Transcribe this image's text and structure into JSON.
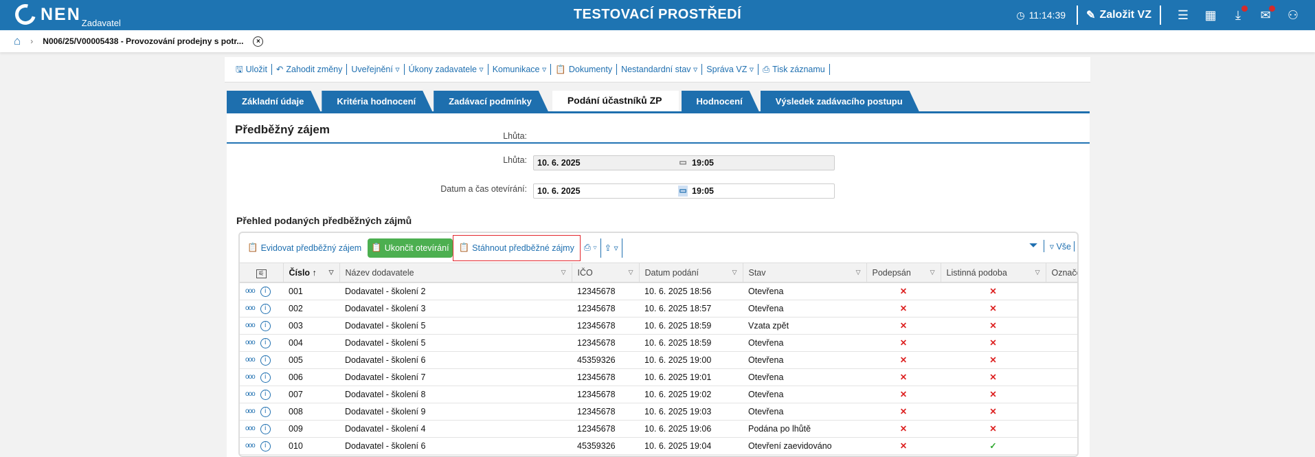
{
  "header": {
    "logo_text": "NEN",
    "logo_sub": "Zadavatel",
    "env_title": "TESTOVACÍ PROSTŘEDÍ",
    "time": "11:14:39",
    "create_label": "Založit VZ"
  },
  "breadcrumb": {
    "title": "N006/25/V00005438 - Provozování prodejny s potr..."
  },
  "toolbar": [
    "Uložit",
    "Zahodit změny",
    "Uveřejnění ▿",
    "Úkony zadavatele ▿",
    "Komunikace ▿",
    "Dokumenty",
    "Nestandardní stav ▿",
    "Správa VZ ▿",
    "Tisk záznamu"
  ],
  "tabs": [
    "Základní údaje",
    "Kritéria hodnocení",
    "Zadávací podmínky",
    "Podání účastníků ZP",
    "Hodnocení",
    "Výsledek zadávacího postupu"
  ],
  "section": {
    "title": "Předběžný zájem",
    "lhuta": {
      "label": "Lhůta:",
      "date": "10. 6. 2025",
      "time": "19:05"
    },
    "otevirani": {
      "label": "Datum a čas otevírání:",
      "date": "10. 6. 2025",
      "time": "19:05"
    }
  },
  "grid": {
    "title": "Přehled podaných předběžných zájmů",
    "buttons": {
      "evidovat": "Evidovat předběžný zájem",
      "ukoncit": "Ukončit otevírání",
      "stahnout": "Stáhnout předběžné zájmy",
      "all": "Vše"
    },
    "columns": [
      "Číslo",
      "Název dodavatele",
      "IČO",
      "Datum podání",
      "Stav",
      "Podepsán",
      "Listinná podoba",
      "Označe"
    ],
    "rows": [
      {
        "cislo": "001",
        "nazev": "Dodavatel - školení 2",
        "ico": "12345678",
        "datum": "10. 6. 2025 18:56",
        "stav": "Otevřena",
        "podepsan": "✕",
        "listinna": "✕"
      },
      {
        "cislo": "002",
        "nazev": "Dodavatel - školení 3",
        "ico": "12345678",
        "datum": "10. 6. 2025 18:57",
        "stav": "Otevřena",
        "podepsan": "✕",
        "listinna": "✕"
      },
      {
        "cislo": "003",
        "nazev": "Dodavatel - školení 5",
        "ico": "12345678",
        "datum": "10. 6. 2025 18:59",
        "stav": "Vzata zpět",
        "podepsan": "✕",
        "listinna": "✕"
      },
      {
        "cislo": "004",
        "nazev": "Dodavatel - školení 5",
        "ico": "12345678",
        "datum": "10. 6. 2025 18:59",
        "stav": "Otevřena",
        "podepsan": "✕",
        "listinna": "✕"
      },
      {
        "cislo": "005",
        "nazev": "Dodavatel - školení 6",
        "ico": "45359326",
        "datum": "10. 6. 2025 19:00",
        "stav": "Otevřena",
        "podepsan": "✕",
        "listinna": "✕"
      },
      {
        "cislo": "006",
        "nazev": "Dodavatel - školení 7",
        "ico": "12345678",
        "datum": "10. 6. 2025 19:01",
        "stav": "Otevřena",
        "podepsan": "✕",
        "listinna": "✕"
      },
      {
        "cislo": "007",
        "nazev": "Dodavatel - školení 8",
        "ico": "12345678",
        "datum": "10. 6. 2025 19:02",
        "stav": "Otevřena",
        "podepsan": "✕",
        "listinna": "✕"
      },
      {
        "cislo": "008",
        "nazev": "Dodavatel - školení 9",
        "ico": "12345678",
        "datum": "10. 6. 2025 19:03",
        "stav": "Otevřena",
        "podepsan": "✕",
        "listinna": "✕"
      },
      {
        "cislo": "009",
        "nazev": "Dodavatel - školení 4",
        "ico": "12345678",
        "datum": "10. 6. 2025 19:06",
        "stav": "Podána po lhůtě",
        "podepsan": "✕",
        "listinna": "✕"
      },
      {
        "cislo": "010",
        "nazev": "Dodavatel - školení 6",
        "ico": "45359326",
        "datum": "10. 6. 2025 19:04",
        "stav": "Otevření zaevidováno",
        "podepsan": "✕",
        "listinna": "✓"
      }
    ]
  }
}
